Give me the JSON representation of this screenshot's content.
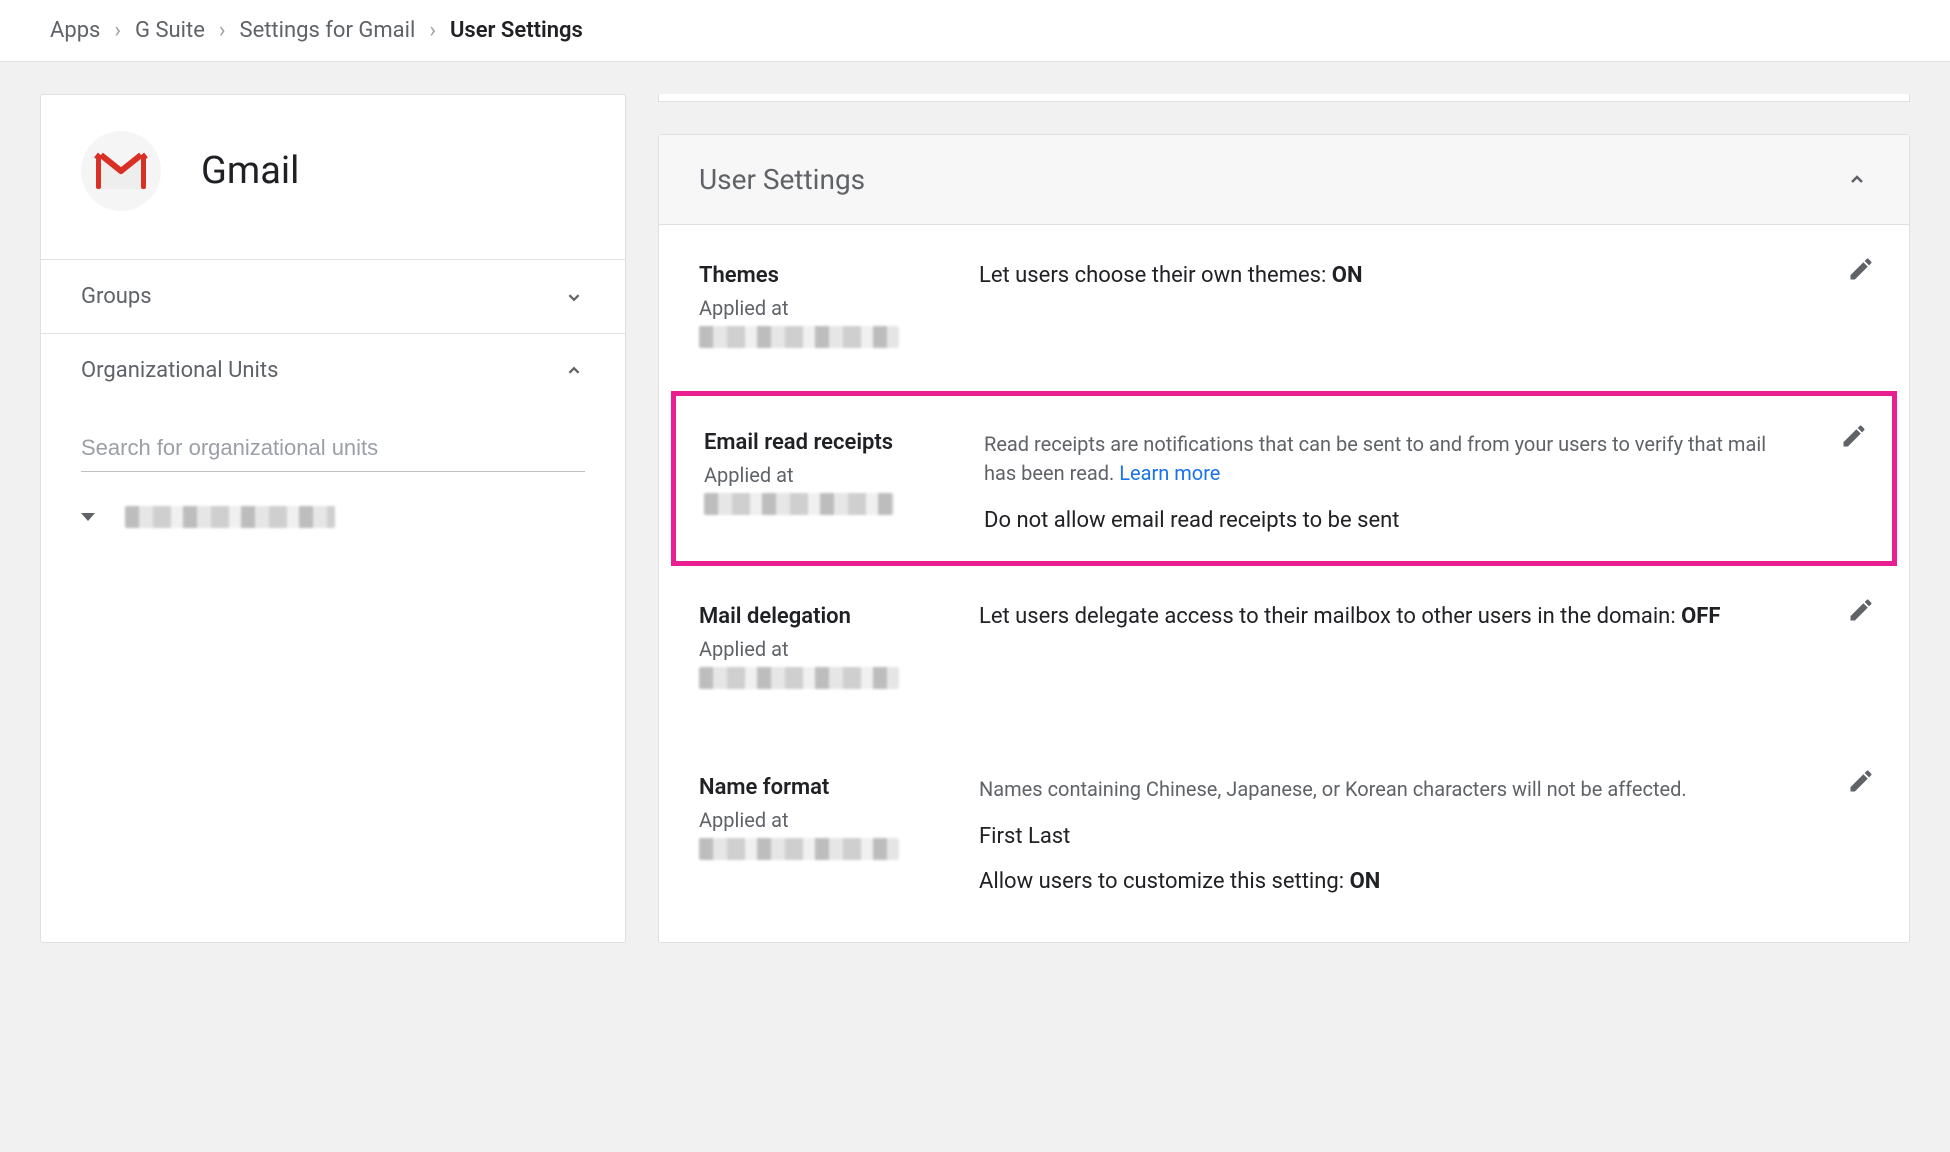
{
  "breadcrumb": {
    "items": [
      "Apps",
      "G Suite",
      "Settings for Gmail",
      "User Settings"
    ]
  },
  "sidebar": {
    "app_title": "Gmail",
    "groups_label": "Groups",
    "ou_label": "Organizational Units",
    "ou_search_placeholder": "Search for organizational units"
  },
  "panel": {
    "title": "User Settings"
  },
  "settings": {
    "themes": {
      "title": "Themes",
      "applied_label": "Applied at",
      "value_prefix": "Let users choose their own themes: ",
      "value_state": "ON"
    },
    "receipts": {
      "title": "Email read receipts",
      "applied_label": "Applied at",
      "desc": "Read receipts are notifications that can be sent to and from your users to verify that mail has been read. ",
      "learn_more": "Learn more",
      "value": "Do not allow email read receipts to be sent"
    },
    "delegation": {
      "title": "Mail delegation",
      "applied_label": "Applied at",
      "value_prefix": "Let users delegate access to their mailbox to other users in the domain: ",
      "value_state": "OFF"
    },
    "nameformat": {
      "title": "Name format",
      "applied_label": "Applied at",
      "desc": "Names containing Chinese, Japanese, or Korean characters will not be affected.",
      "line1": "First Last",
      "line2_prefix": "Allow users to customize this setting: ",
      "line2_state": "ON"
    }
  }
}
